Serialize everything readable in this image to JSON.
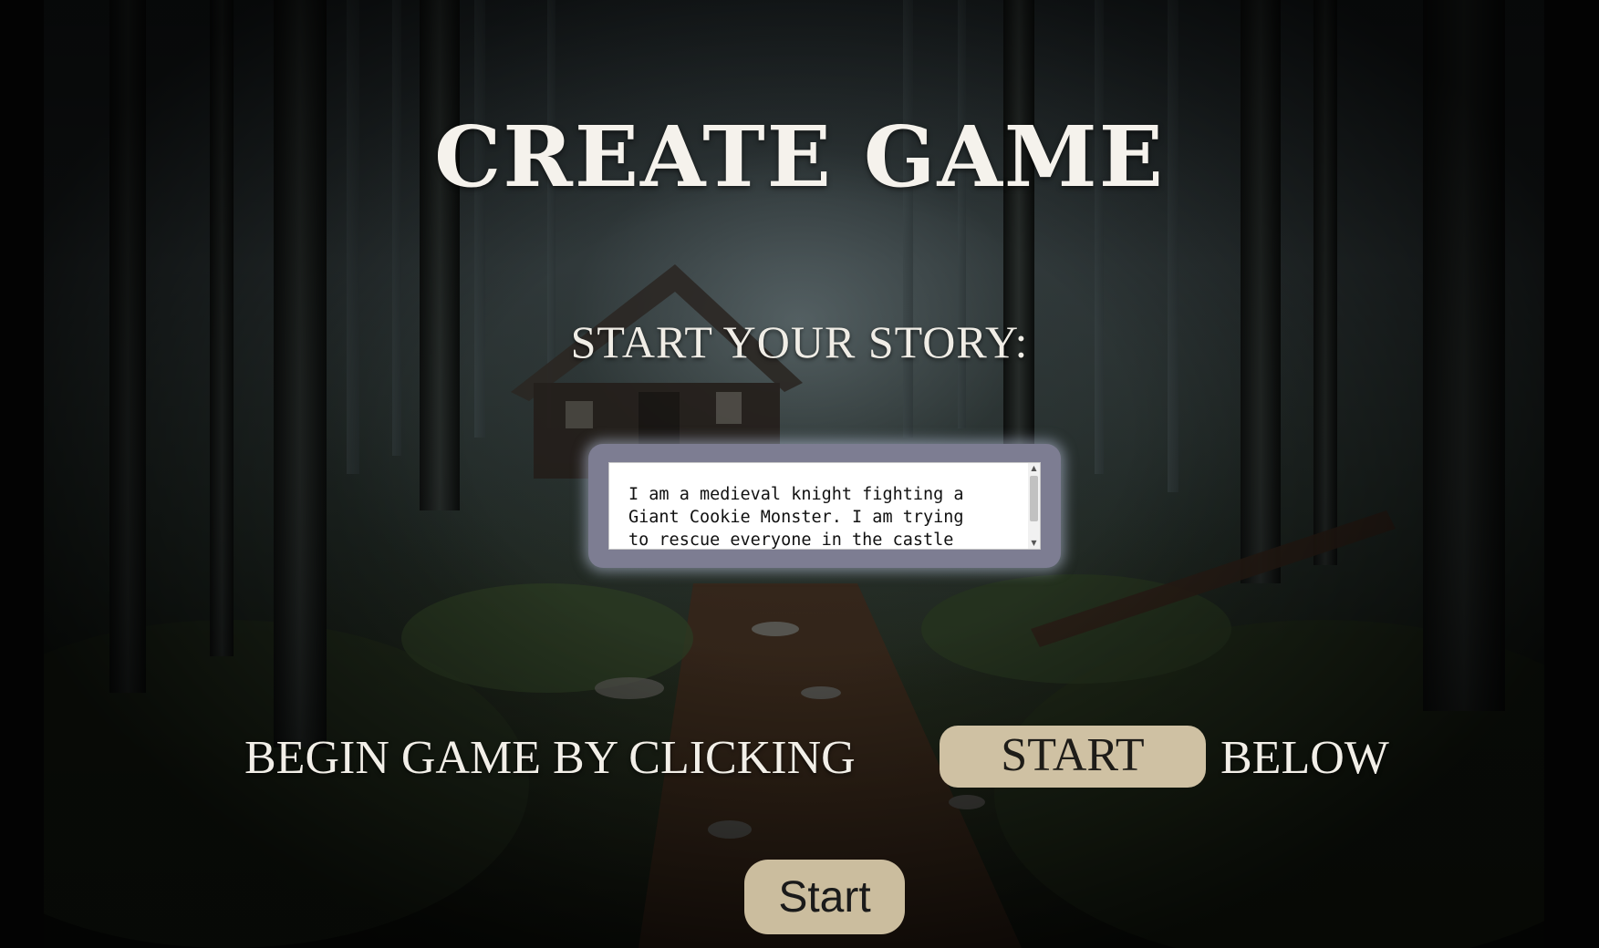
{
  "title": "CREATE GAME",
  "subtitle": "START YOUR STORY:",
  "story": {
    "value": "I am a medieval knight fighting a Giant Cookie Monster. I am trying to rescue everyone in the castle"
  },
  "instruction": {
    "before": "BEGIN GAME BY CLICKING",
    "highlight": "START",
    "after": "BELOW"
  },
  "start_button": {
    "label": "Start"
  },
  "colors": {
    "button_bg": "#cbbd9e",
    "frame": "#7d7d92",
    "text": "#f5f2ec"
  }
}
